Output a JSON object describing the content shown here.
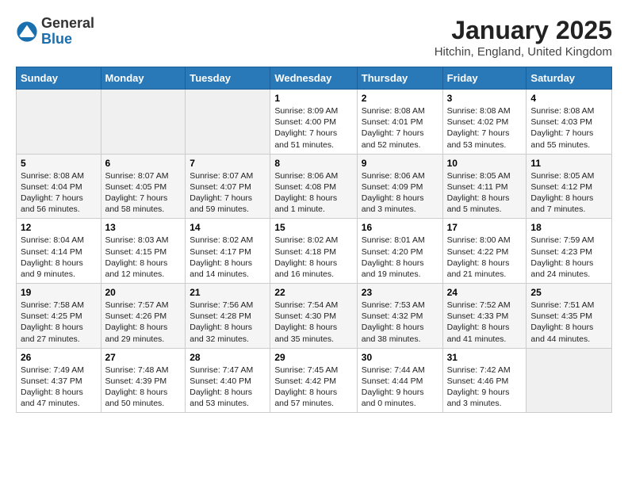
{
  "logo": {
    "general": "General",
    "blue": "Blue"
  },
  "title": "January 2025",
  "location": "Hitchin, England, United Kingdom",
  "days_of_week": [
    "Sunday",
    "Monday",
    "Tuesday",
    "Wednesday",
    "Thursday",
    "Friday",
    "Saturday"
  ],
  "weeks": [
    [
      {
        "day": "",
        "info": ""
      },
      {
        "day": "",
        "info": ""
      },
      {
        "day": "",
        "info": ""
      },
      {
        "day": "1",
        "info": "Sunrise: 8:09 AM\nSunset: 4:00 PM\nDaylight: 7 hours and 51 minutes."
      },
      {
        "day": "2",
        "info": "Sunrise: 8:08 AM\nSunset: 4:01 PM\nDaylight: 7 hours and 52 minutes."
      },
      {
        "day": "3",
        "info": "Sunrise: 8:08 AM\nSunset: 4:02 PM\nDaylight: 7 hours and 53 minutes."
      },
      {
        "day": "4",
        "info": "Sunrise: 8:08 AM\nSunset: 4:03 PM\nDaylight: 7 hours and 55 minutes."
      }
    ],
    [
      {
        "day": "5",
        "info": "Sunrise: 8:08 AM\nSunset: 4:04 PM\nDaylight: 7 hours and 56 minutes."
      },
      {
        "day": "6",
        "info": "Sunrise: 8:07 AM\nSunset: 4:05 PM\nDaylight: 7 hours and 58 minutes."
      },
      {
        "day": "7",
        "info": "Sunrise: 8:07 AM\nSunset: 4:07 PM\nDaylight: 7 hours and 59 minutes."
      },
      {
        "day": "8",
        "info": "Sunrise: 8:06 AM\nSunset: 4:08 PM\nDaylight: 8 hours and 1 minute."
      },
      {
        "day": "9",
        "info": "Sunrise: 8:06 AM\nSunset: 4:09 PM\nDaylight: 8 hours and 3 minutes."
      },
      {
        "day": "10",
        "info": "Sunrise: 8:05 AM\nSunset: 4:11 PM\nDaylight: 8 hours and 5 minutes."
      },
      {
        "day": "11",
        "info": "Sunrise: 8:05 AM\nSunset: 4:12 PM\nDaylight: 8 hours and 7 minutes."
      }
    ],
    [
      {
        "day": "12",
        "info": "Sunrise: 8:04 AM\nSunset: 4:14 PM\nDaylight: 8 hours and 9 minutes."
      },
      {
        "day": "13",
        "info": "Sunrise: 8:03 AM\nSunset: 4:15 PM\nDaylight: 8 hours and 12 minutes."
      },
      {
        "day": "14",
        "info": "Sunrise: 8:02 AM\nSunset: 4:17 PM\nDaylight: 8 hours and 14 minutes."
      },
      {
        "day": "15",
        "info": "Sunrise: 8:02 AM\nSunset: 4:18 PM\nDaylight: 8 hours and 16 minutes."
      },
      {
        "day": "16",
        "info": "Sunrise: 8:01 AM\nSunset: 4:20 PM\nDaylight: 8 hours and 19 minutes."
      },
      {
        "day": "17",
        "info": "Sunrise: 8:00 AM\nSunset: 4:22 PM\nDaylight: 8 hours and 21 minutes."
      },
      {
        "day": "18",
        "info": "Sunrise: 7:59 AM\nSunset: 4:23 PM\nDaylight: 8 hours and 24 minutes."
      }
    ],
    [
      {
        "day": "19",
        "info": "Sunrise: 7:58 AM\nSunset: 4:25 PM\nDaylight: 8 hours and 27 minutes."
      },
      {
        "day": "20",
        "info": "Sunrise: 7:57 AM\nSunset: 4:26 PM\nDaylight: 8 hours and 29 minutes."
      },
      {
        "day": "21",
        "info": "Sunrise: 7:56 AM\nSunset: 4:28 PM\nDaylight: 8 hours and 32 minutes."
      },
      {
        "day": "22",
        "info": "Sunrise: 7:54 AM\nSunset: 4:30 PM\nDaylight: 8 hours and 35 minutes."
      },
      {
        "day": "23",
        "info": "Sunrise: 7:53 AM\nSunset: 4:32 PM\nDaylight: 8 hours and 38 minutes."
      },
      {
        "day": "24",
        "info": "Sunrise: 7:52 AM\nSunset: 4:33 PM\nDaylight: 8 hours and 41 minutes."
      },
      {
        "day": "25",
        "info": "Sunrise: 7:51 AM\nSunset: 4:35 PM\nDaylight: 8 hours and 44 minutes."
      }
    ],
    [
      {
        "day": "26",
        "info": "Sunrise: 7:49 AM\nSunset: 4:37 PM\nDaylight: 8 hours and 47 minutes."
      },
      {
        "day": "27",
        "info": "Sunrise: 7:48 AM\nSunset: 4:39 PM\nDaylight: 8 hours and 50 minutes."
      },
      {
        "day": "28",
        "info": "Sunrise: 7:47 AM\nSunset: 4:40 PM\nDaylight: 8 hours and 53 minutes."
      },
      {
        "day": "29",
        "info": "Sunrise: 7:45 AM\nSunset: 4:42 PM\nDaylight: 8 hours and 57 minutes."
      },
      {
        "day": "30",
        "info": "Sunrise: 7:44 AM\nSunset: 4:44 PM\nDaylight: 9 hours and 0 minutes."
      },
      {
        "day": "31",
        "info": "Sunrise: 7:42 AM\nSunset: 4:46 PM\nDaylight: 9 hours and 3 minutes."
      },
      {
        "day": "",
        "info": ""
      }
    ]
  ]
}
